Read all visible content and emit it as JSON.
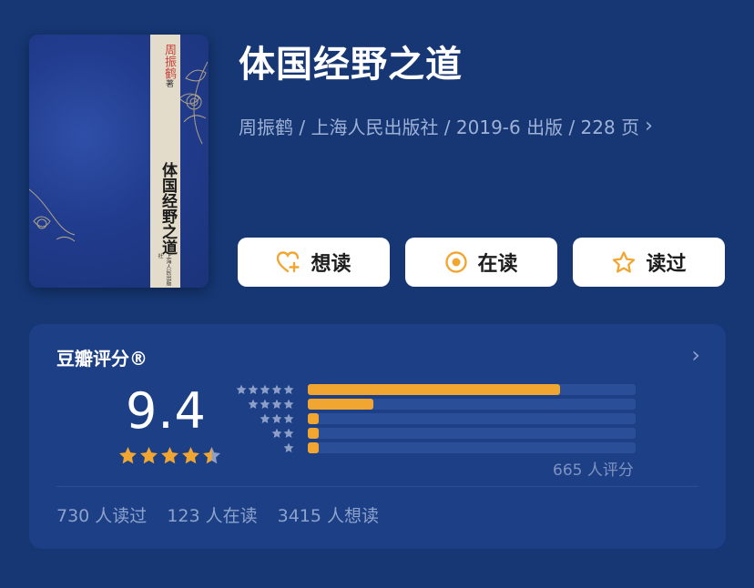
{
  "book": {
    "title": "体国经野之道",
    "meta": "周振鹤 / 上海人民出版社 / 2019-6 出版 / 228 页",
    "cover": {
      "author_calligraphy": "周振鹤",
      "author_suffix": "著",
      "title": "体国经野之道",
      "publisher": "上海人民出版社"
    }
  },
  "actions": [
    {
      "label": "想读",
      "icon": "heart-plus-icon"
    },
    {
      "label": "在读",
      "icon": "target-icon"
    },
    {
      "label": "读过",
      "icon": "star-outline-icon"
    }
  ],
  "rating": {
    "title": "豆瓣评分®",
    "score": "9.4",
    "stars": 4.5,
    "count_text": "665 人评分",
    "distribution": [
      {
        "stars": 5,
        "fraction": 0.77
      },
      {
        "stars": 4,
        "fraction": 0.2
      },
      {
        "stars": 3,
        "fraction": 0.02
      },
      {
        "stars": 2,
        "fraction": 0.01
      },
      {
        "stars": 1,
        "fraction": 0.01
      }
    ]
  },
  "stats": {
    "read": "730 人读过",
    "reading": "123 人在读",
    "want": "3415 人想读"
  },
  "colors": {
    "background": "#163774",
    "card": "#1c3f86",
    "accent": "#f2a632",
    "button": "#ffffff"
  }
}
